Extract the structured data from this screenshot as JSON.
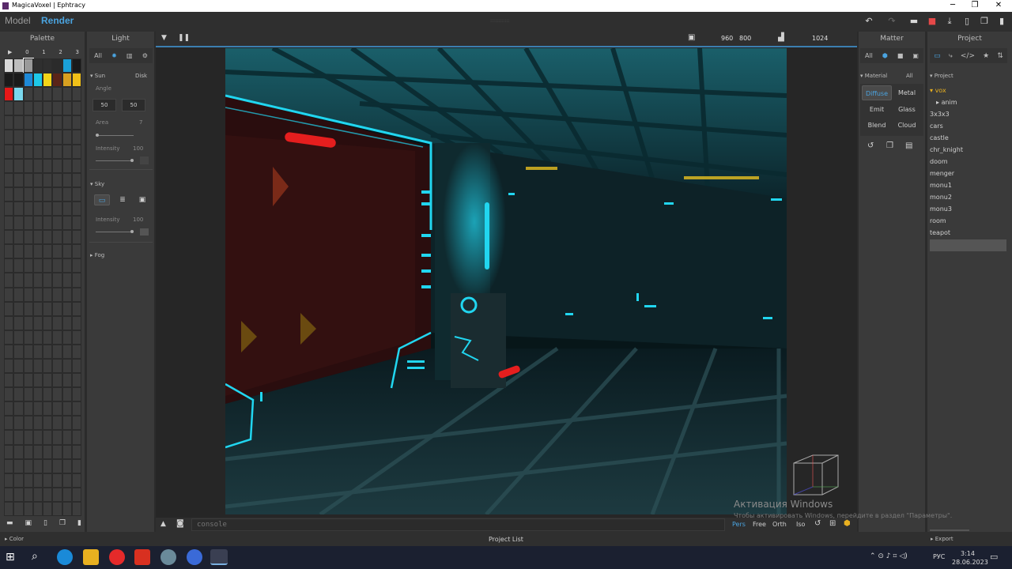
{
  "window": {
    "title": "MagicaVoxel | Ephtracy",
    "controls": [
      "─",
      "❐",
      "✕"
    ]
  },
  "app": {
    "modes": [
      "Model",
      "Render"
    ],
    "active_mode": "Render",
    "toolbar": [
      "undo-icon",
      "redo-icon",
      "open-folder-icon",
      "save-icon",
      "export-icon",
      "new-file-icon",
      "copy-file-icon",
      "delete-icon"
    ],
    "drag_handle": "::::::::::::"
  },
  "palette": {
    "title": "Palette",
    "index_labels": [
      "▶",
      "0",
      "1",
      "2",
      "3"
    ],
    "colors": [
      "#d9d9d9",
      "#bdbdbd",
      "#9a9a9a",
      "#2f2f2f",
      "#2f2f2f",
      "#2b2b2b",
      "#1aa0d8",
      "#1a1a1a",
      "#1a1a1a",
      "#1a1a1a",
      "#1e8ad8",
      "#1ec8e8",
      "#f2d418",
      "#5a2418",
      "#d8a020",
      "#f0c018",
      "#e81818",
      "#7ad8ee"
    ],
    "footer_icons": [
      "open-icon",
      "save-icon",
      "new-icon",
      "copy-icon",
      "delete-icon"
    ],
    "color_section": "Color"
  },
  "light": {
    "title": "Light",
    "filters": [
      "All",
      "sun-icon",
      "chart-icon",
      "gear-icon"
    ],
    "sun": {
      "label": "Sun",
      "mode": "Disk",
      "angle_label": "Angle",
      "angle_values": [
        "50",
        "50"
      ],
      "area_label": "Area",
      "area_value": "7",
      "intensity_label": "Intensity",
      "intensity_value": "100"
    },
    "sky": {
      "label": "Sky",
      "intensity_label": "Intensity",
      "intensity_value": "100"
    },
    "fog_label": "Fog",
    "footer_icons": [
      "square-icon",
      "new-doc-icon",
      "grid-icon",
      "diamond-icon"
    ]
  },
  "viewport": {
    "resolution_w": "960",
    "resolution_h": "800",
    "samples": "1024",
    "console_placeholder": "console",
    "camera_modes": [
      "Pers",
      "Free",
      "Orth",
      "Iso"
    ],
    "active_camera": "Pers",
    "project_list_label": "Project List"
  },
  "matter": {
    "title": "Matter",
    "filters": [
      "All",
      "cube-icon",
      "camera-icon",
      "image-icon"
    ],
    "material_label": "Material",
    "material_all": "All",
    "materials": [
      "Diffuse",
      "Metal",
      "Emit",
      "Glass",
      "Blend",
      "Cloud"
    ],
    "active_material": "Diffuse",
    "actions": [
      "reset-icon",
      "copy-icon",
      "paste-icon"
    ]
  },
  "project": {
    "title": "Project",
    "section": "Project",
    "folder": "vox",
    "subfolder": "anim",
    "items": [
      "3x3x3",
      "cars",
      "castle",
      "chr_knight",
      "doom",
      "menger",
      "monu1",
      "monu2",
      "monu3",
      "room",
      "teapot"
    ],
    "export_label": "Export"
  },
  "watermark": {
    "title": "Активация Windows",
    "text": "Чтобы активировать Windows, перейдите в раздел \"Параметры\"."
  },
  "taskbar": {
    "time": "3:14",
    "date": "28.06.2023",
    "lang": "РУС"
  },
  "colors": {
    "accent": "#4aa3df",
    "cyan_light": "#21d6f0",
    "red_light": "#e51e1e"
  }
}
